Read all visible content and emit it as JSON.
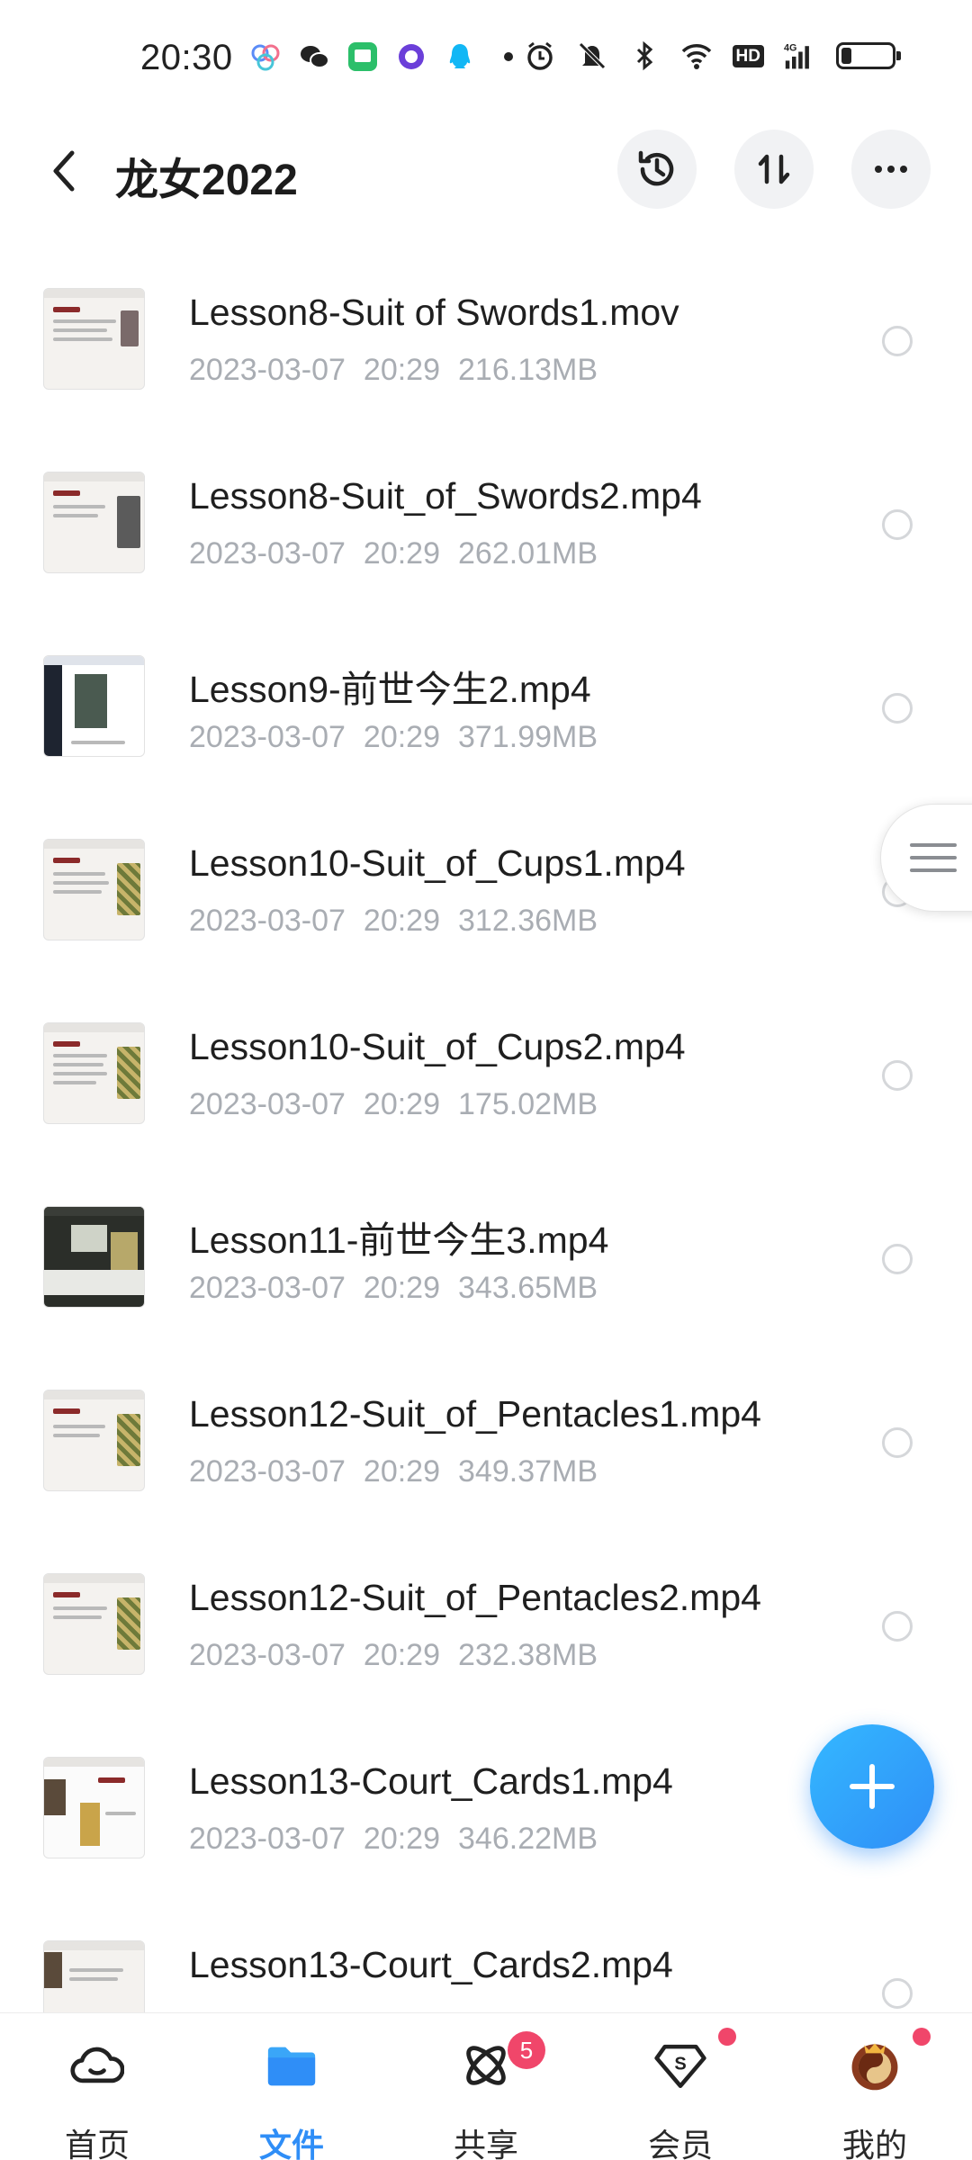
{
  "status_bar": {
    "time": "20:30",
    "hd": "HD",
    "network": "4G",
    "battery_level": 0.2
  },
  "header": {
    "title": "龙女2022",
    "icons": [
      "back-icon",
      "history-icon",
      "sort-icon",
      "more-icon"
    ]
  },
  "files": [
    {
      "name": "Lesson8-Suit of Swords1.mov",
      "date": "2023-03-07",
      "time": "20:29",
      "size": "216.13MB"
    },
    {
      "name": "Lesson8-Suit_of_Swords2.mp4",
      "date": "2023-03-07",
      "time": "20:29",
      "size": "262.01MB"
    },
    {
      "name": "Lesson9-前世今生2.mp4",
      "date": "2023-03-07",
      "time": "20:29",
      "size": "371.99MB"
    },
    {
      "name": "Lesson10-Suit_of_Cups1.mp4",
      "date": "2023-03-07",
      "time": "20:29",
      "size": "312.36MB"
    },
    {
      "name": "Lesson10-Suit_of_Cups2.mp4",
      "date": "2023-03-07",
      "time": "20:29",
      "size": "175.02MB"
    },
    {
      "name": "Lesson11-前世今生3.mp4",
      "date": "2023-03-07",
      "time": "20:29",
      "size": "343.65MB"
    },
    {
      "name": "Lesson12-Suit_of_Pentacles1.mp4",
      "date": "2023-03-07",
      "time": "20:29",
      "size": "349.37MB"
    },
    {
      "name": "Lesson12-Suit_of_Pentacles2.mp4",
      "date": "2023-03-07",
      "time": "20:29",
      "size": "232.38MB"
    },
    {
      "name": "Lesson13-Court_Cards1.mp4",
      "date": "2023-03-07",
      "time": "20:29",
      "size": "346.22MB"
    },
    {
      "name": "Lesson13-Court_Cards2.mp4",
      "date": "",
      "time": "",
      "size": ""
    }
  ],
  "bottom_nav": {
    "items": [
      {
        "label": "首页",
        "icon": "cloud-home-icon"
      },
      {
        "label": "文件",
        "icon": "folder-icon",
        "active": true
      },
      {
        "label": "共享",
        "icon": "share-atom-icon",
        "badge": "5"
      },
      {
        "label": "会员",
        "icon": "vip-diamond-icon",
        "dot": true
      },
      {
        "label": "我的",
        "icon": "avatar-icon",
        "dot": true
      }
    ]
  },
  "colors": {
    "accent": "#2f8ef7",
    "meta_text": "#a9adb3",
    "badge": "#f0466a"
  }
}
